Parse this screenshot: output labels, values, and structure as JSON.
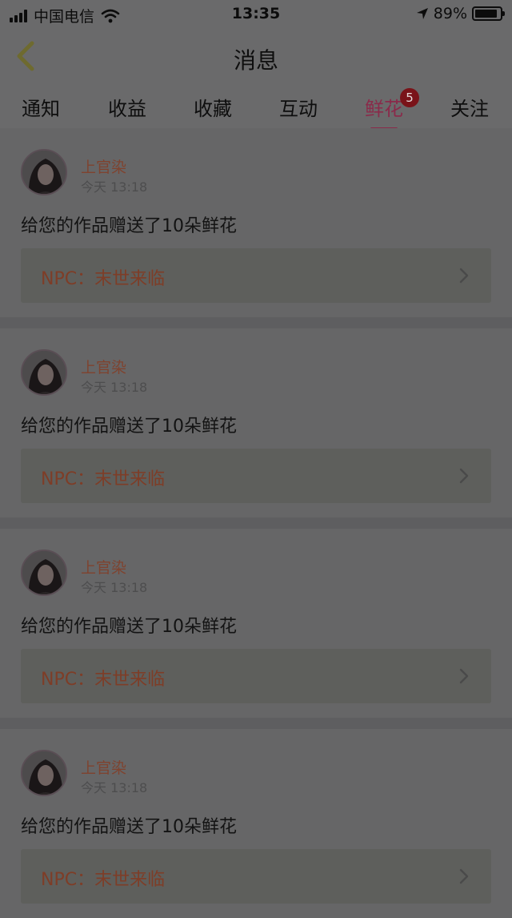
{
  "status_bar": {
    "carrier": "中国电信",
    "time": "13:35",
    "battery": "89%",
    "battery_level": 0.89
  },
  "header": {
    "title": "消息"
  },
  "tabs": [
    {
      "label": "通知"
    },
    {
      "label": "收益"
    },
    {
      "label": "收藏"
    },
    {
      "label": "互动"
    },
    {
      "label": "鲜花",
      "active": true,
      "badge": "5"
    },
    {
      "label": "关注"
    }
  ],
  "messages": [
    {
      "sender": "上官染",
      "time": "今天 13:18",
      "text": "给您的作品赠送了10朵鲜花",
      "work": "NPC：末世来临"
    },
    {
      "sender": "上官染",
      "time": "今天 13:18",
      "text": "给您的作品赠送了10朵鲜花",
      "work": "NPC：末世来临"
    },
    {
      "sender": "上官染",
      "time": "今天 13:18",
      "text": "给您的作品赠送了10朵鲜花",
      "work": "NPC：末世来临"
    },
    {
      "sender": "上官染",
      "time": "今天 13:18",
      "text": "给您的作品赠送了10朵鲜花",
      "work": "NPC：末世来临"
    }
  ],
  "colors": {
    "accent": "#8a2a4a",
    "sender": "#7f432f",
    "badge": "#7a1319"
  }
}
